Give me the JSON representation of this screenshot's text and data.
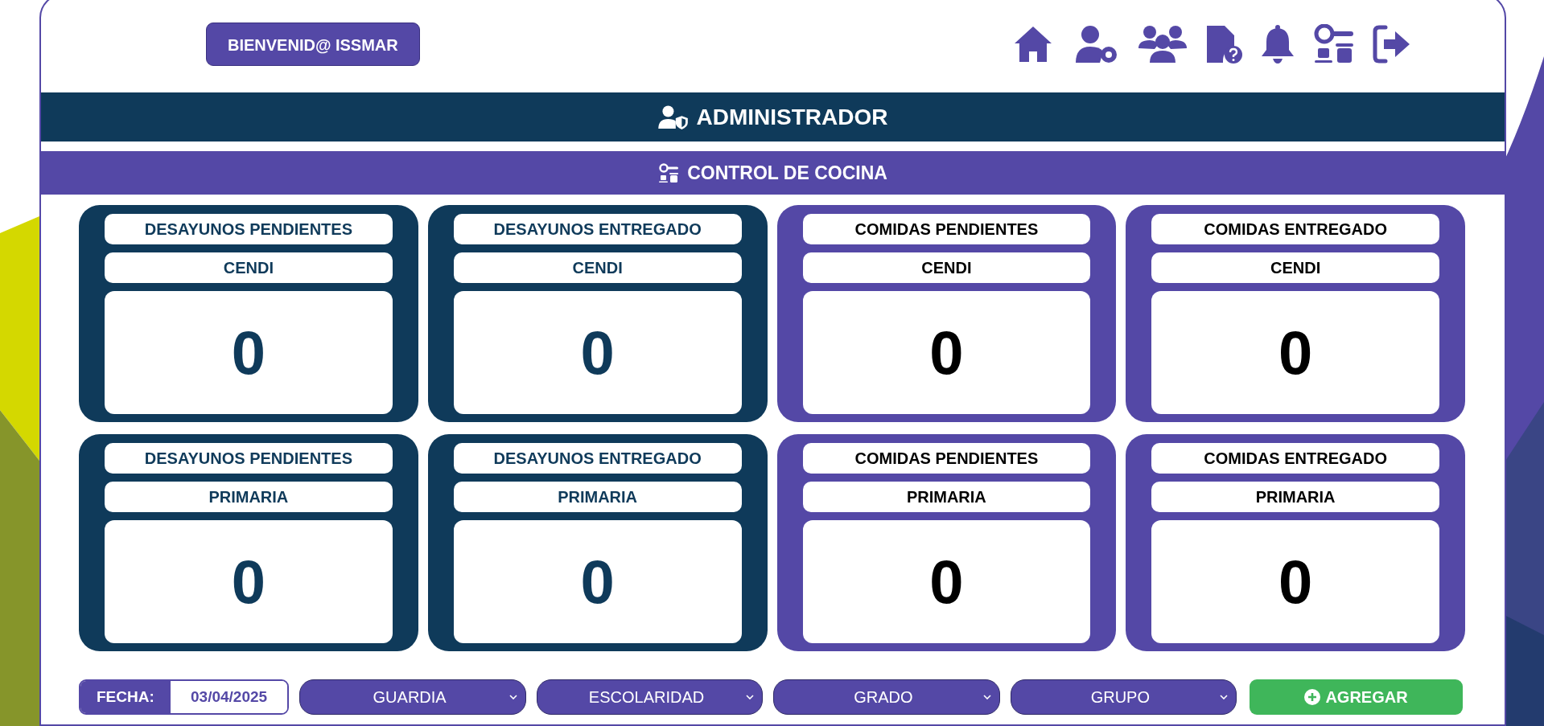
{
  "header": {
    "welcome": "BIENVENID@ ISSMAR"
  },
  "role_bar": {
    "title": "ADMINISTRADOR"
  },
  "section_bar": {
    "title": "CONTROL DE COCINA"
  },
  "tiles": [
    {
      "kind": "breakfast",
      "title": "DESAYUNOS PENDIENTES",
      "level_name": "CENDI",
      "count": "0"
    },
    {
      "kind": "breakfast",
      "title": "DESAYUNOS ENTREGADO",
      "level_name": "CENDI",
      "count": "0"
    },
    {
      "kind": "lunch",
      "title": "COMIDAS PENDIENTES",
      "level_name": "CENDI",
      "count": "0"
    },
    {
      "kind": "lunch",
      "title": "COMIDAS ENTREGADO",
      "level_name": "CENDI",
      "count": "0"
    },
    {
      "kind": "breakfast",
      "title": "DESAYUNOS PENDIENTES",
      "level_name": "PRIMARIA",
      "count": "0"
    },
    {
      "kind": "breakfast",
      "title": "DESAYUNOS ENTREGADO",
      "level_name": "PRIMARIA",
      "count": "0"
    },
    {
      "kind": "lunch",
      "title": "COMIDAS PENDIENTES",
      "level_name": "PRIMARIA",
      "count": "0"
    },
    {
      "kind": "lunch",
      "title": "COMIDAS ENTREGADO",
      "level_name": "PRIMARIA",
      "count": "0"
    }
  ],
  "filters": {
    "date_label": "FECHA:",
    "date_value": "03/04/2025",
    "dropdowns": [
      "GUARDIA",
      "ESCOLARIDAD",
      "GRADO",
      "GRUPO"
    ],
    "add_button": "AGREGAR"
  }
}
